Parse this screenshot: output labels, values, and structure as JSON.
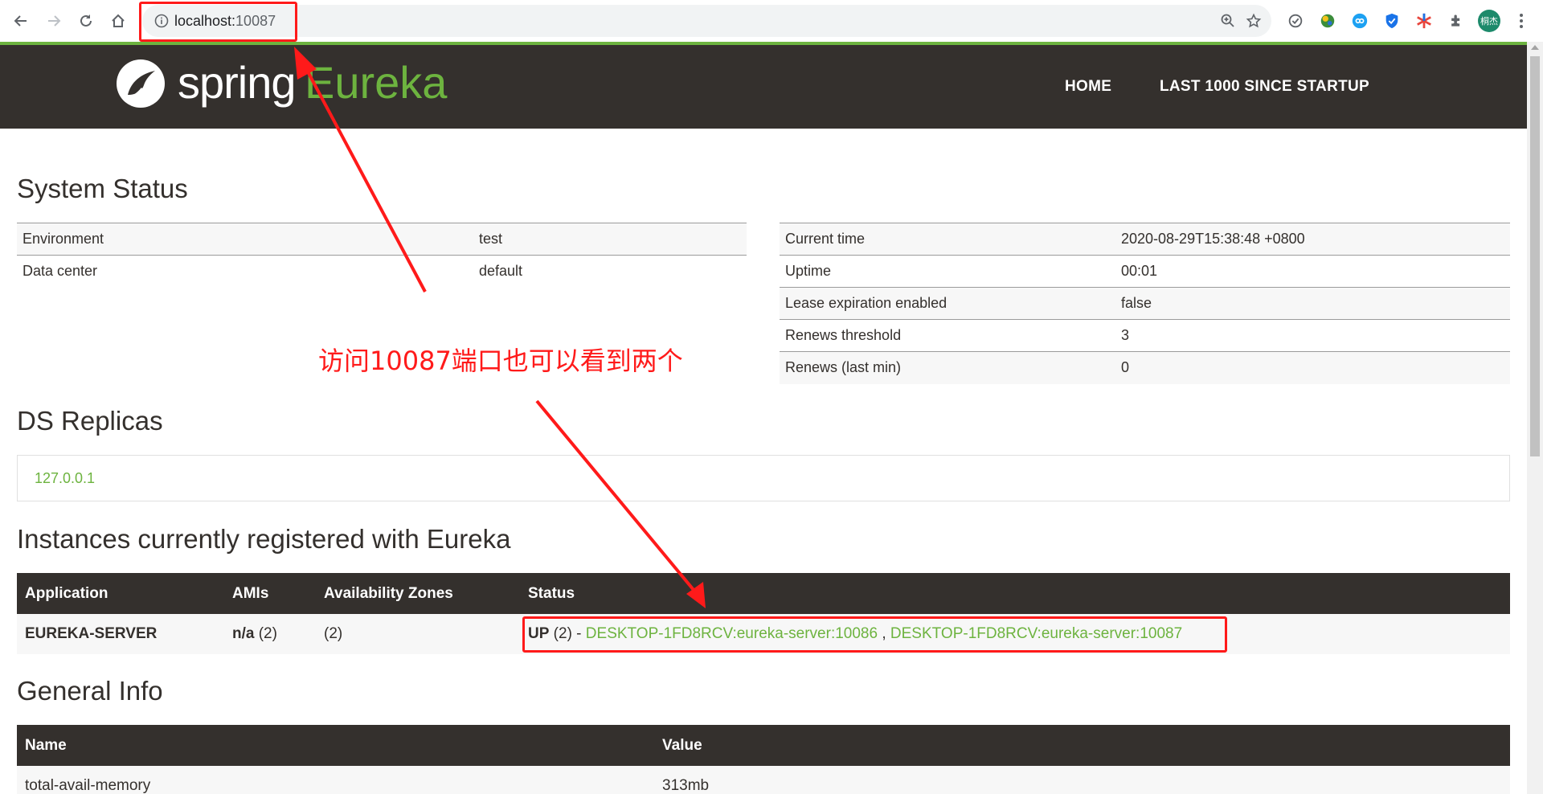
{
  "browser": {
    "url_host": "localhost:",
    "url_port": "10087",
    "avatar_text": "桐杰",
    "icons": [
      "back-icon",
      "forward-icon",
      "reload-icon",
      "home-icon",
      "info-icon",
      "zoom-icon",
      "star-icon",
      "extensions-icon",
      "menu-icon"
    ]
  },
  "header": {
    "logo_spring": "spring",
    "logo_eureka": "Eureka",
    "nav": [
      "HOME",
      "LAST 1000 SINCE STARTUP"
    ],
    "accent_color": "#6db33f",
    "bar_color": "#34302d"
  },
  "system_status": {
    "title": "System Status",
    "left": [
      {
        "key": "Environment",
        "value": "test"
      },
      {
        "key": "Data center",
        "value": "default"
      }
    ],
    "right": [
      {
        "key": "Current time",
        "value": "2020-08-29T15:38:48 +0800"
      },
      {
        "key": "Uptime",
        "value": "00:01"
      },
      {
        "key": "Lease expiration enabled",
        "value": "false"
      },
      {
        "key": "Renews threshold",
        "value": "3"
      },
      {
        "key": "Renews (last min)",
        "value": "0"
      }
    ]
  },
  "ds_replicas": {
    "title": "DS Replicas",
    "items": [
      "127.0.0.1"
    ]
  },
  "instances": {
    "title": "Instances currently registered with Eureka",
    "headers": [
      "Application",
      "AMIs",
      "Availability Zones",
      "Status"
    ],
    "rows": [
      {
        "application": "EUREKA-SERVER",
        "amis_bold": "n/a",
        "amis_count": " (2)",
        "zones": "(2)",
        "status_up": "UP",
        "status_count": " (2) - ",
        "instance_1": "DESKTOP-1FD8RCV:eureka-server:10086",
        "separator": " , ",
        "instance_2": "DESKTOP-1FD8RCV:eureka-server:10087"
      }
    ]
  },
  "general_info": {
    "title": "General Info",
    "headers": [
      "Name",
      "Value"
    ],
    "rows": [
      {
        "name": "total-avail-memory",
        "value": "313mb"
      }
    ]
  },
  "annotation": {
    "text": "访问10087端口也可以看到两个",
    "color": "#ff1a1a"
  }
}
